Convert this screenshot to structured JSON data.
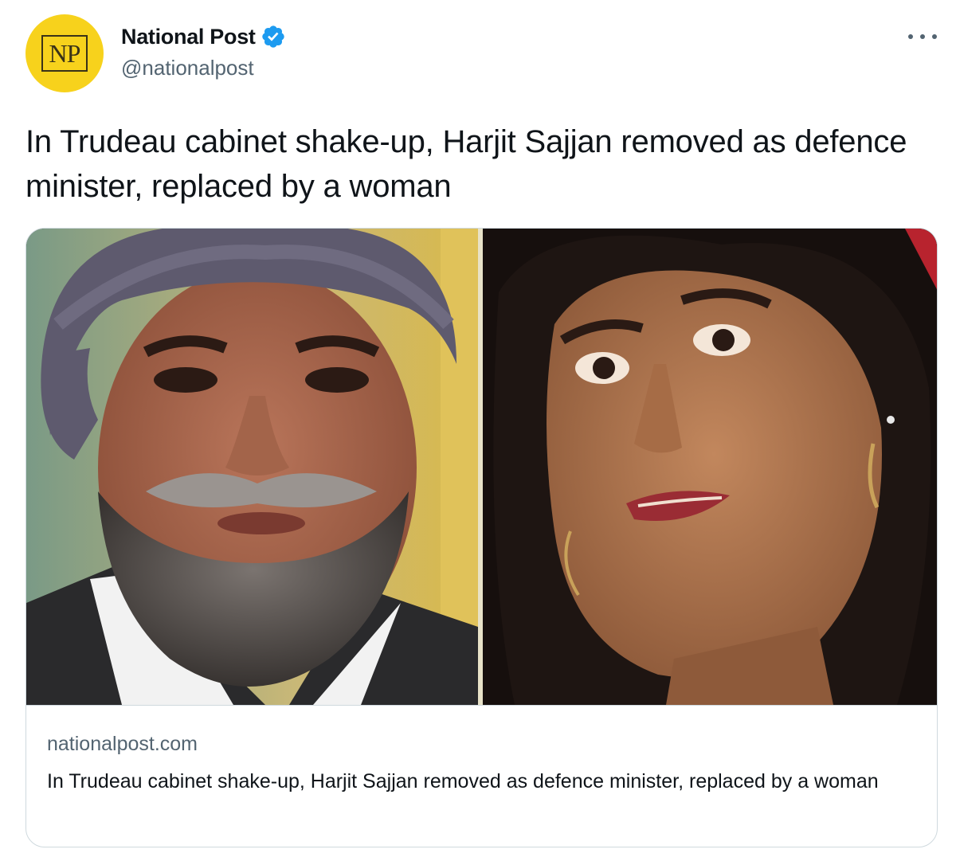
{
  "author": {
    "name": "National Post",
    "handle": "@nationalpost",
    "avatar_text": "NP",
    "verified": true
  },
  "tweet_text": "In Trudeau cabinet shake-up, Harjit Sajjan removed as defence minister, replaced by a woman",
  "card": {
    "domain": "nationalpost.com",
    "title": "In Trudeau cabinet shake-up, Harjit Sajjan removed as defence minister, replaced by a woman",
    "images": [
      "photo-man-turban",
      "photo-woman-speaking"
    ]
  },
  "colors": {
    "avatar_bg": "#f7d21c",
    "verified_blue": "#1d9bf0",
    "secondary_text": "#536471",
    "border": "#cfd9de"
  },
  "icons": {
    "verified": "verified-badge-icon",
    "more": "more-horizontal-icon"
  }
}
